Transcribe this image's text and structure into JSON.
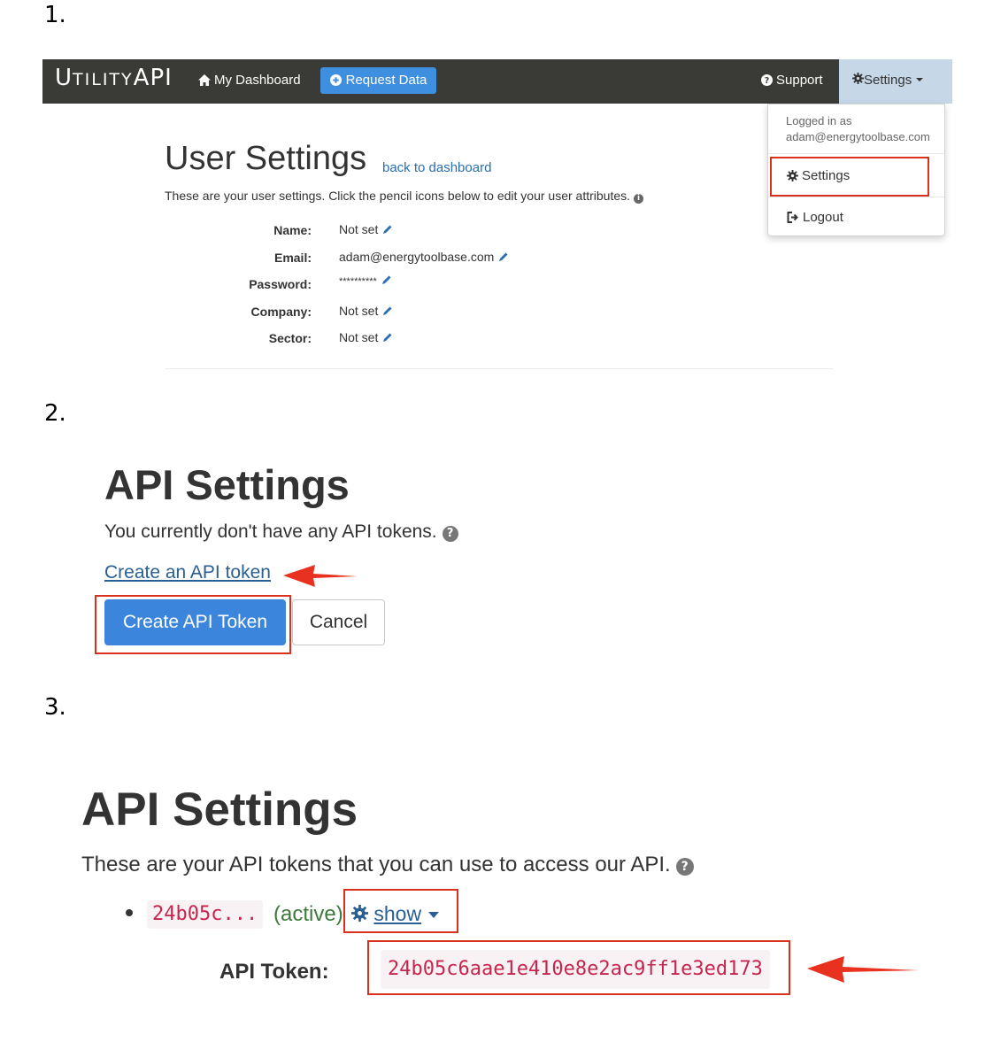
{
  "steps": {
    "step1": "1.",
    "step2": "2.",
    "step3": "3."
  },
  "navbar": {
    "logo_first": "U",
    "logo_mid": "TILITY",
    "logo_last": "API",
    "dashboard": "My Dashboard",
    "request_data": "Request Data",
    "support": "Support",
    "settings": "Settings",
    "colors": {
      "bar": "#3a3a36",
      "request_button": "#3f8fe0",
      "settings_active": "#c6d7e8"
    }
  },
  "dropdown": {
    "logged_in_label": "Logged in as",
    "email": "adam@energytoolbase.com",
    "settings_item": "Settings",
    "logout_item": "Logout"
  },
  "user_settings": {
    "title": "User Settings",
    "back_link": "back to dashboard",
    "description": "These are your user settings. Click the pencil icons below to edit your user attributes.",
    "fields": [
      {
        "label": "Name:",
        "value": "Not set"
      },
      {
        "label": "Email:",
        "value": "adam@energytoolbase.com"
      },
      {
        "label": "Password:",
        "value": "**********"
      },
      {
        "label": "Company:",
        "value": "Not set"
      },
      {
        "label": "Sector:",
        "value": "Not set"
      }
    ]
  },
  "api_step2": {
    "title": "API Settings",
    "description": "You currently don't have any API tokens.",
    "create_link": "Create an API token",
    "create_button": "Create API Token",
    "cancel_button": "Cancel"
  },
  "api_step3": {
    "title": "API Settings",
    "description": "These are your API tokens that you can use to access our API.",
    "token_short": "24b05c...",
    "token_status": "(active)",
    "show_label": "show",
    "token_label": "API Token:",
    "token_full": "24b05c6aae1e410e8e2ac9ff1e3ed173"
  },
  "annotation_color": "#d9311e"
}
